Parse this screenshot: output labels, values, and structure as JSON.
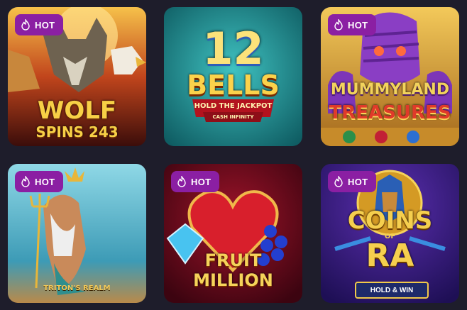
{
  "badge_label": "HOT",
  "colors": {
    "page_bg": "#1e1d2b",
    "badge_bg": "#8b1fa3",
    "badge_text": "#ffffff"
  },
  "games": [
    {
      "title_line1": "WOLF",
      "title_line2": "SPINS 243",
      "hot": true,
      "icon": "wolf-eagle-lynx-art"
    },
    {
      "title_line1": "12",
      "title_line2": "BELLS",
      "subtitle": "HOLD THE JACKPOT",
      "subtitle2": "CASH INFINITY",
      "hot": false,
      "icon": "bells-logo-art"
    },
    {
      "title_line1": "MUMMYLAND",
      "title_line2": "TREASURES",
      "hot": true,
      "icon": "mummy-art"
    },
    {
      "title_line1": "TRITON'S REALM",
      "hot": true,
      "icon": "triton-art"
    },
    {
      "title_line1": "FRUIT",
      "title_line2": "MILLION",
      "hot": true,
      "icon": "heart-diamond-art"
    },
    {
      "title_line1": "COINS",
      "title_of": "OF",
      "title_line2": "RA",
      "subtitle": "HOLD & WIN",
      "hot": true,
      "icon": "pharaoh-coin-art"
    }
  ]
}
